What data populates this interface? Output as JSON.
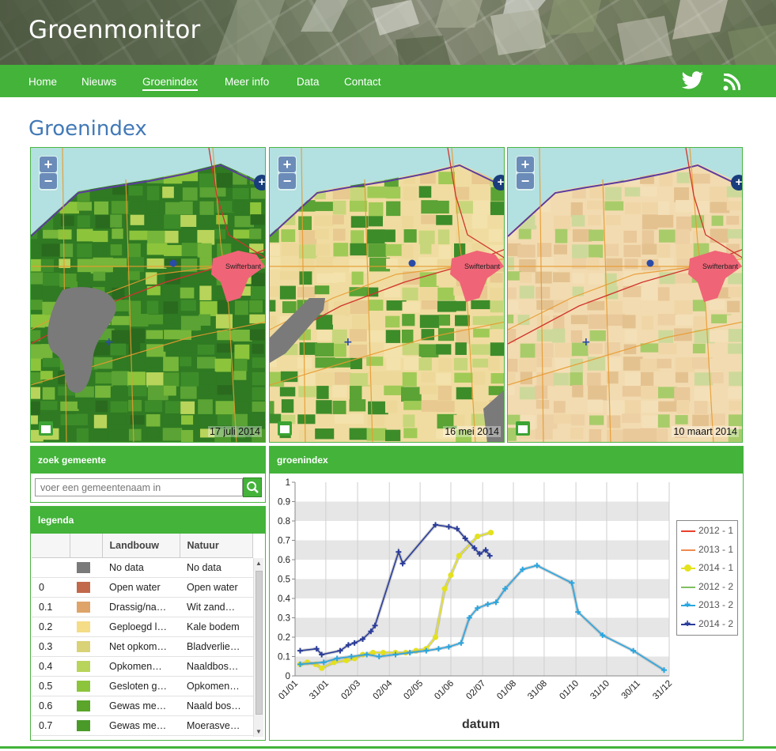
{
  "site": {
    "title": "Groenmonitor"
  },
  "nav": {
    "items": [
      "Home",
      "Nieuws",
      "Groenindex",
      "Meer info",
      "Data",
      "Contact"
    ],
    "active": "Groenindex",
    "icons": [
      "twitter-icon",
      "rss-icon"
    ]
  },
  "page": {
    "title": "Groenindex"
  },
  "maps": [
    {
      "date": "17 juli 2014",
      "town": "Swifterbant",
      "style": "green"
    },
    {
      "date": "16 mei 2014",
      "town": "Swifterbant",
      "style": "mixed"
    },
    {
      "date": "10 maart 2014",
      "town": "Swifterbant",
      "style": "bare"
    }
  ],
  "search": {
    "heading": "zoek gemeente",
    "placeholder": "voer een gemeentenaam in"
  },
  "legend": {
    "heading": "legenda",
    "columns": [
      "",
      "",
      "Landbouw",
      "Natuur"
    ],
    "rows": [
      {
        "value": "",
        "color": "#7a7a7a",
        "landbouw": "No data",
        "natuur": "No data"
      },
      {
        "value": "0",
        "color": "#c1694a",
        "landbouw": "Open water",
        "natuur": "Open water"
      },
      {
        "value": "0.1",
        "color": "#dea46a",
        "landbouw": "Drassig/na…",
        "natuur": "Wit zand…"
      },
      {
        "value": "0.2",
        "color": "#f5dc86",
        "landbouw": "Geploegd l…",
        "natuur": "Kale bodem"
      },
      {
        "value": "0.3",
        "color": "#d9d276",
        "landbouw": "Net opkom…",
        "natuur": "Bladverlie…"
      },
      {
        "value": "0.4",
        "color": "#b8d45a",
        "landbouw": "Opkomen…",
        "natuur": "Naaldbos…"
      },
      {
        "value": "0.5",
        "color": "#8cc43c",
        "landbouw": "Gesloten g…",
        "natuur": "Opkomen…"
      },
      {
        "value": "0.6",
        "color": "#5aa52a",
        "landbouw": "Gewas me…",
        "natuur": "Naald bos…"
      },
      {
        "value": "0.7",
        "color": "#4a9a2a",
        "landbouw": "Gewas me…",
        "natuur": "Moerasve…"
      }
    ]
  },
  "chart_heading": "groenindex",
  "chart_data": {
    "type": "line",
    "xlabel": "datum",
    "ylabel": "",
    "ylim": [
      0,
      1
    ],
    "yticks": [
      "0",
      "0.1",
      "0.2",
      "0.3",
      "0.4",
      "0.5",
      "0.6",
      "0.7",
      "0.8",
      "0.9",
      "1"
    ],
    "xticks": [
      "01/01",
      "31/01",
      "02/03",
      "02/04",
      "02/05",
      "01/06",
      "02/07",
      "01/08",
      "31/08",
      "01/10",
      "31/10",
      "30/11",
      "31/12"
    ],
    "x_unit": "day of year",
    "series": [
      {
        "name": "2012 - 1",
        "color": "#e8402c",
        "marker": "none",
        "points": []
      },
      {
        "name": "2013 - 1",
        "color": "#f08a50",
        "marker": "none",
        "points": []
      },
      {
        "name": "2014 - 1",
        "color": "#e4e21c",
        "marker": "dot",
        "points": [
          [
            5,
            0.06
          ],
          [
            12,
            0.07
          ],
          [
            20,
            0.06
          ],
          [
            26,
            0.04
          ],
          [
            38,
            0.07
          ],
          [
            50,
            0.08
          ],
          [
            58,
            0.09
          ],
          [
            66,
            0.11
          ],
          [
            76,
            0.12
          ],
          [
            86,
            0.12
          ],
          [
            98,
            0.12
          ],
          [
            108,
            0.12
          ],
          [
            118,
            0.13
          ],
          [
            128,
            0.14
          ],
          [
            137,
            0.2
          ],
          [
            146,
            0.45
          ],
          [
            152,
            0.52
          ],
          [
            160,
            0.62
          ],
          [
            178,
            0.72
          ],
          [
            191,
            0.74
          ]
        ]
      },
      {
        "name": "2012 - 2",
        "color": "#80c060",
        "marker": "none",
        "points": []
      },
      {
        "name": "2013 - 2",
        "color": "#2aa6e0",
        "marker": "plus",
        "points": [
          [
            5,
            0.06
          ],
          [
            28,
            0.07
          ],
          [
            41,
            0.09
          ],
          [
            55,
            0.1
          ],
          [
            70,
            0.11
          ],
          [
            82,
            0.1
          ],
          [
            98,
            0.11
          ],
          [
            112,
            0.12
          ],
          [
            128,
            0.13
          ],
          [
            140,
            0.14
          ],
          [
            150,
            0.15
          ],
          [
            162,
            0.17
          ],
          [
            170,
            0.3
          ],
          [
            178,
            0.35
          ],
          [
            188,
            0.37
          ],
          [
            196,
            0.38
          ],
          [
            205,
            0.45
          ],
          [
            222,
            0.55
          ],
          [
            236,
            0.57
          ],
          [
            270,
            0.48
          ],
          [
            276,
            0.33
          ],
          [
            300,
            0.21
          ],
          [
            330,
            0.13
          ],
          [
            360,
            0.03
          ]
        ]
      },
      {
        "name": "2014 - 2",
        "color": "#2a3c9a",
        "marker": "plus",
        "points": [
          [
            5,
            0.13
          ],
          [
            21,
            0.14
          ],
          [
            26,
            0.11
          ],
          [
            44,
            0.13
          ],
          [
            52,
            0.16
          ],
          [
            58,
            0.17
          ],
          [
            66,
            0.19
          ],
          [
            74,
            0.23
          ],
          [
            78,
            0.26
          ],
          [
            101,
            0.64
          ],
          [
            105,
            0.58
          ],
          [
            137,
            0.78
          ],
          [
            150,
            0.77
          ],
          [
            158,
            0.76
          ],
          [
            166,
            0.71
          ],
          [
            175,
            0.66
          ],
          [
            180,
            0.63
          ],
          [
            186,
            0.65
          ],
          [
            190,
            0.62
          ]
        ]
      }
    ]
  }
}
